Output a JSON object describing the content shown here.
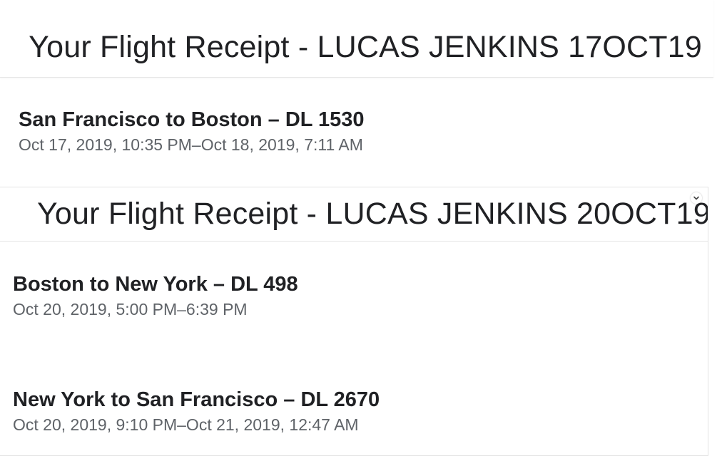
{
  "receipts": [
    {
      "title": "Your Flight Receipt - LUCAS JENKINS 17OCT19",
      "flights": [
        {
          "route": "San Francisco to Boston – DL 1530",
          "times": "Oct 17, 2019, 10:35 PM–Oct 18, 2019, 7:11 AM"
        }
      ]
    },
    {
      "title": "Your Flight Receipt - LUCAS JENKINS 20OCT19",
      "flights": [
        {
          "route": "Boston to New York – DL 498",
          "times": "Oct 20, 2019, 5:00 PM–6:39 PM"
        },
        {
          "route": "New York to San Francisco – DL 2670",
          "times": "Oct 20, 2019, 9:10 PM–Oct 21, 2019, 12:47 AM"
        }
      ]
    }
  ],
  "icons": {
    "expand": "chevron-down-icon"
  }
}
